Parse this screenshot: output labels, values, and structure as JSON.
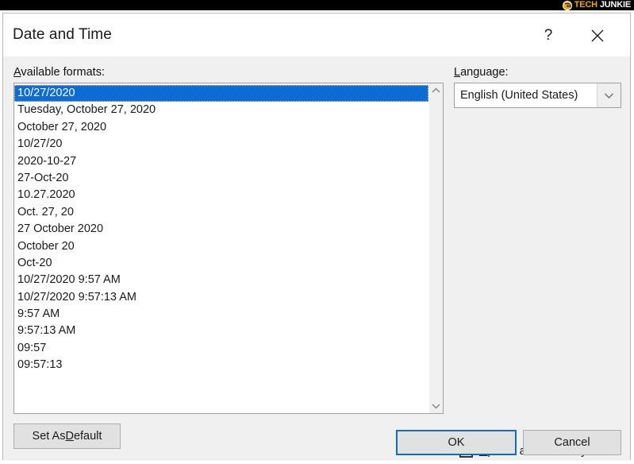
{
  "watermark": {
    "badge_initials": "TJ",
    "brand_first": "TECH",
    "brand_second": "JUNKIE",
    "brand_color": "#f0a800",
    "background_color": "#000000"
  },
  "dialog": {
    "title": "Date and Time",
    "help_label": "?",
    "close_label": "✕"
  },
  "formats": {
    "label_accelerator": "A",
    "label_rest": "vailable formats:",
    "selected_index": 0,
    "selection_color": "#0a6cd4",
    "items": [
      "10/27/2020",
      "Tuesday, October 27, 2020",
      "October 27, 2020",
      "10/27/20",
      "2020-10-27",
      "27-Oct-20",
      "10.27.2020",
      "Oct. 27, 20",
      "27 October 2020",
      "October 20",
      "Oct-20",
      "10/27/2020 9:57 AM",
      "10/27/2020 9:57:13 AM",
      "9:57 AM",
      "9:57:13 AM",
      "09:57",
      "09:57:13"
    ],
    "scroll_up_name": "scroll-up-arrow",
    "scroll_down_name": "scroll-down-arrow"
  },
  "language": {
    "label_accelerator": "L",
    "label_rest": "anguage:",
    "selected_value": "English (United States)",
    "options": [
      "English (United States)"
    ]
  },
  "update_automatically": {
    "label_accelerator": "U",
    "label_rest": "pdate automatically",
    "checked": false
  },
  "buttons": {
    "set_as_default_pre": "Set As ",
    "set_as_default_accelerator": "D",
    "set_as_default_rest": "efault",
    "ok": "OK",
    "cancel": "Cancel",
    "default_focus_color": "#0a6cd4"
  }
}
